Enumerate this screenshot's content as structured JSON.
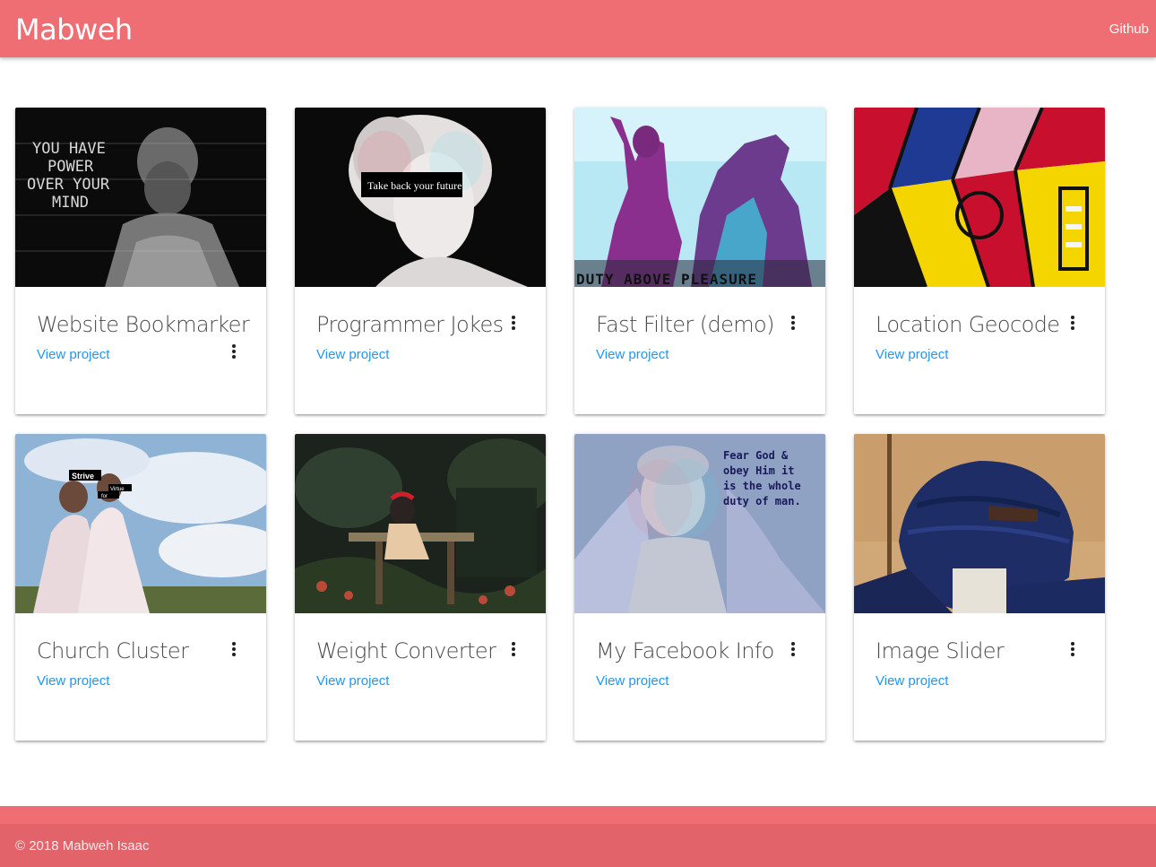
{
  "app": {
    "brand": "Mabweh",
    "nav_link": "Github"
  },
  "colors": {
    "primary": "#ef6e73",
    "footer_copyright": "#e3636b",
    "link": "#2196f3"
  },
  "projects": [
    {
      "title": "Website Bookmarker",
      "link_label": "View project",
      "image_text": "YOU HAVE POWER OVER YOUR MIND",
      "menu_icon": "more-vert-icon"
    },
    {
      "title": "Programmer Jokes",
      "link_label": "View project",
      "image_text": "Take back your future",
      "menu_icon": "more-vert-icon"
    },
    {
      "title": "Fast Filter (demo)",
      "link_label": "View project",
      "image_text": "DUTY ABOVE PLEASURE",
      "menu_icon": "more-vert-icon"
    },
    {
      "title": "Location Geocode",
      "link_label": "View project",
      "image_text": "",
      "menu_icon": "more-vert-icon"
    },
    {
      "title": "Church Cluster",
      "link_label": "View project",
      "image_text": "Strive for Virtue",
      "menu_icon": "more-vert-icon"
    },
    {
      "title": "Weight Converter",
      "link_label": "View project",
      "image_text": "",
      "menu_icon": "more-vert-icon"
    },
    {
      "title": "My Facebook Info",
      "link_label": "View project",
      "image_text": "Fear God & obey Him it is the whole duty of man.",
      "menu_icon": "more-vert-icon"
    },
    {
      "title": "Image Slider",
      "link_label": "View project",
      "image_text": "",
      "menu_icon": "more-vert-icon"
    }
  ],
  "footer": {
    "copyright": "© 2018 Mabweh Isaac"
  }
}
